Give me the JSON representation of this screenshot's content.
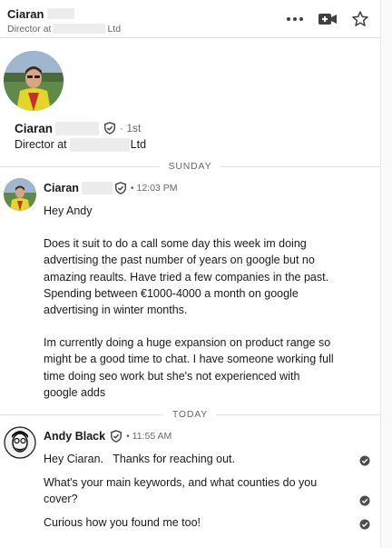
{
  "header": {
    "contact_name": "Ciaran",
    "subtitle_prefix": "Director at",
    "subtitle_suffix": "Ltd",
    "icons": [
      "more-options-icon",
      "video-call-icon",
      "star-icon"
    ]
  },
  "profile": {
    "name": "Ciaran",
    "degree": "· 1st",
    "title_prefix": "Director at",
    "title_suffix": "Ltd"
  },
  "dividers": {
    "first": "SUNDAY",
    "second": "TODAY"
  },
  "messages": [
    {
      "author": "Ciaran",
      "time": "• 12:03 PM",
      "paragraphs": [
        "Hey Andy",
        "Does it suit to do a call some day this week im doing advertising the past number of years on google but no amazing reaults. Have tried a few companies in the past. Spending between €1000-4000 a month on google advertising in winter months.",
        "Im currently doing a huge expansion on product range so might be a good time to chat. I have someone working full time doing seo work but she's not experienced with google adds"
      ]
    },
    {
      "author": "Andy Black",
      "time": "• 11:55 AM",
      "replies": [
        "Hey Ciaran.   Thanks for reaching out.",
        "What's your main keywords, and what counties do you cover?",
        "Curious how you found me too!"
      ]
    }
  ],
  "colors": {
    "text": "#191919",
    "muted": "#666666",
    "divider": "#e0dfdc",
    "check": "#4d4d4d"
  }
}
